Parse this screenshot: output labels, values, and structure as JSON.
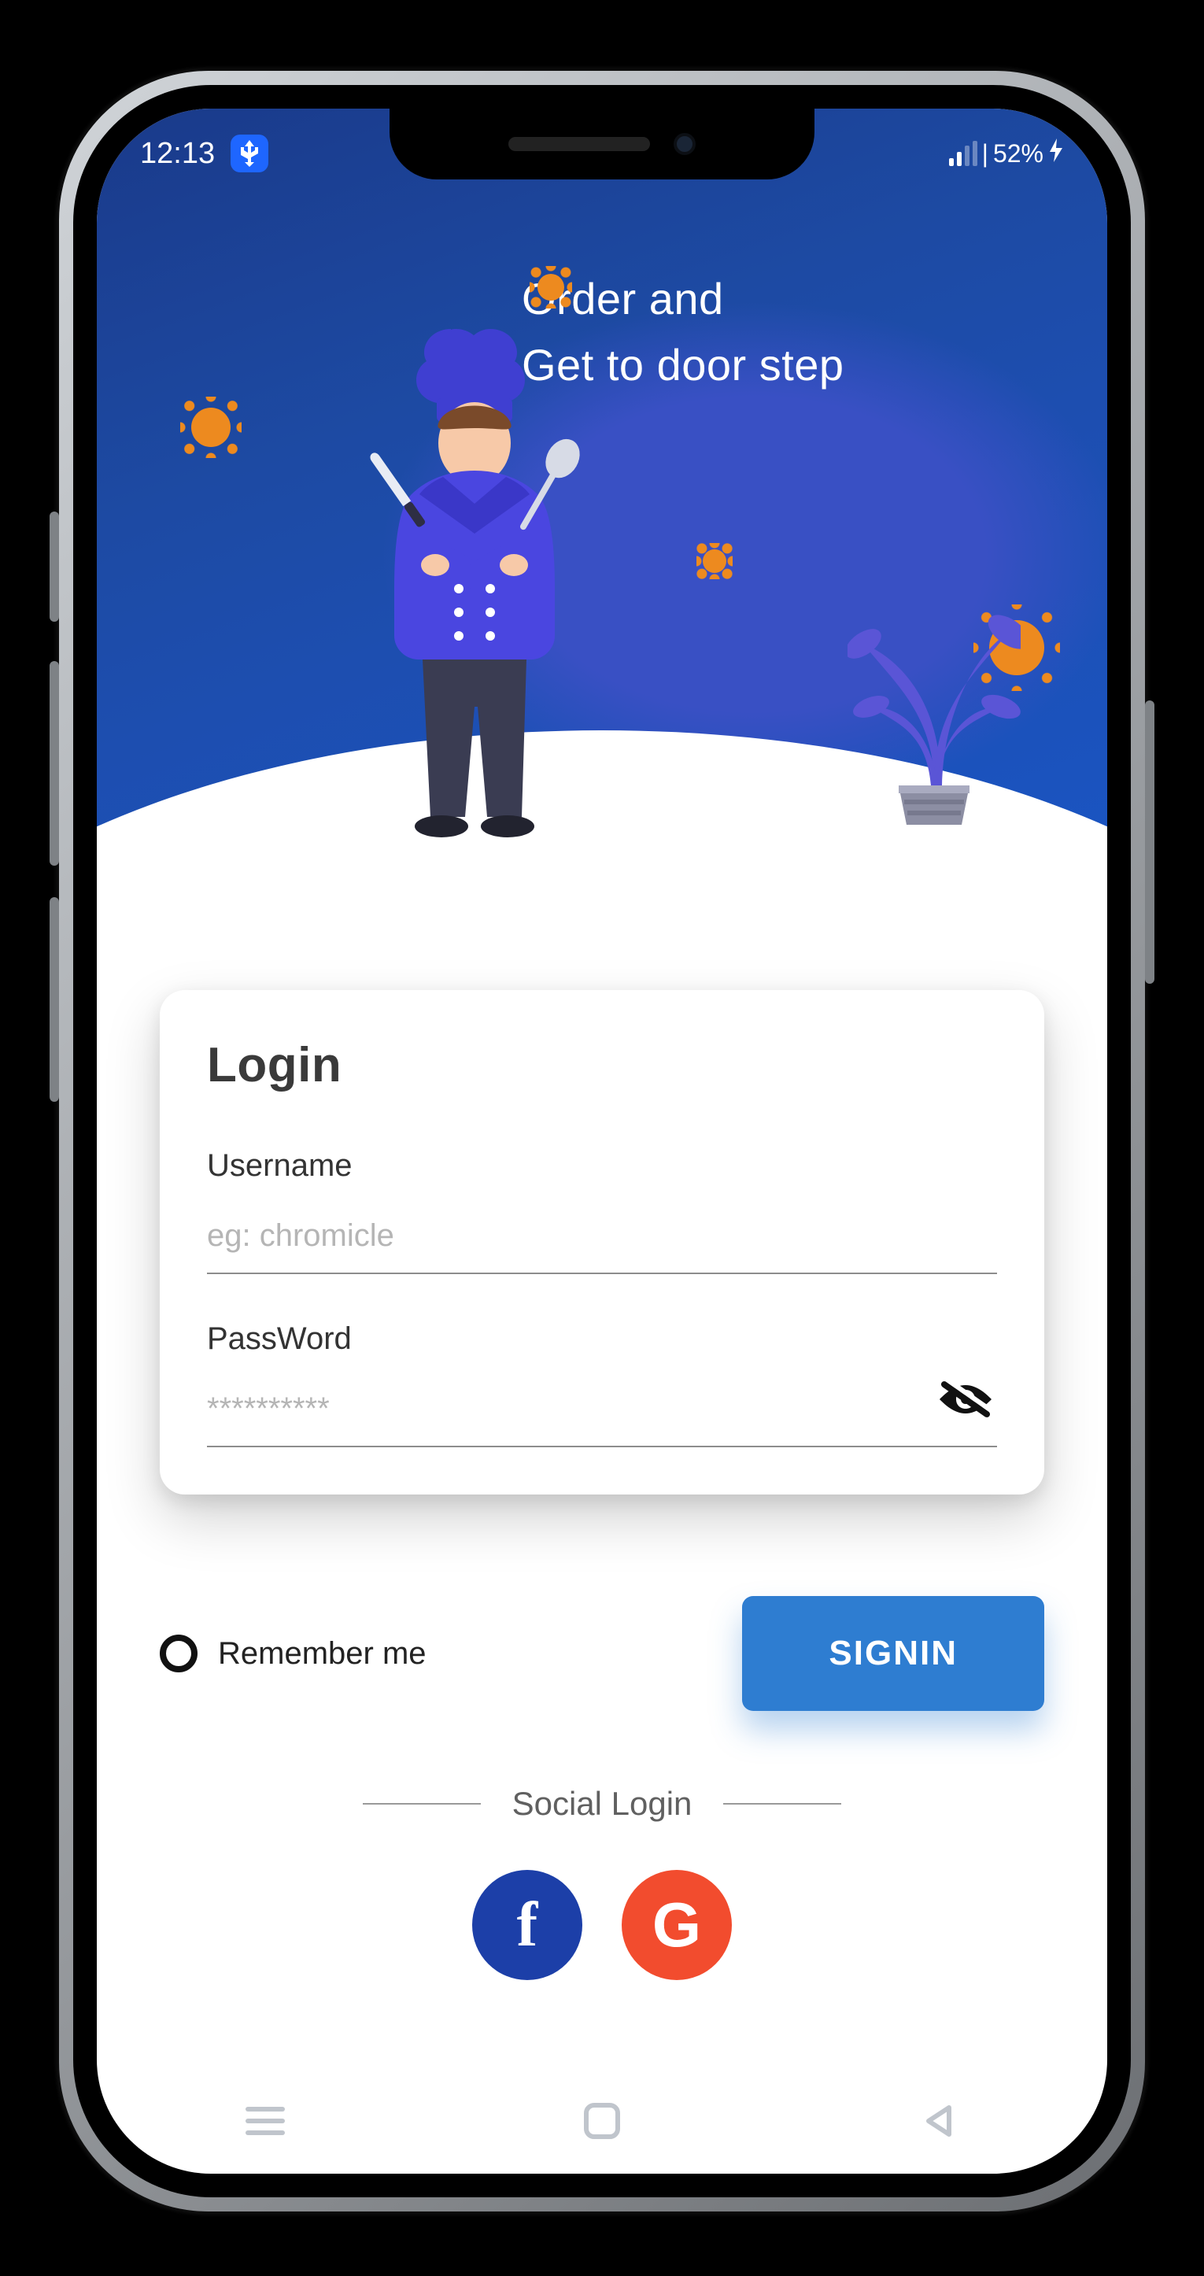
{
  "status": {
    "time": "12:13",
    "battery_text": "52%"
  },
  "hero": {
    "line1": "Order and",
    "line2": "Get to door step"
  },
  "login": {
    "title": "Login",
    "username_label": "Username",
    "username_placeholder": "eg: chromicle",
    "password_label": "PassWord",
    "password_placeholder": "**********"
  },
  "actions": {
    "remember_label": "Remember me",
    "signin_label": "SIGNIN"
  },
  "social": {
    "title": "Social Login",
    "facebook_glyph": "f",
    "google_glyph": "G"
  },
  "colors": {
    "primary_button": "#2e7dd1",
    "facebook": "#1c3fa8",
    "google": "#f24c2e",
    "hero_gradient_from": "#1a3a8a",
    "hero_gradient_to": "#1a55c4",
    "accent_orange": "#ed8a1f"
  }
}
